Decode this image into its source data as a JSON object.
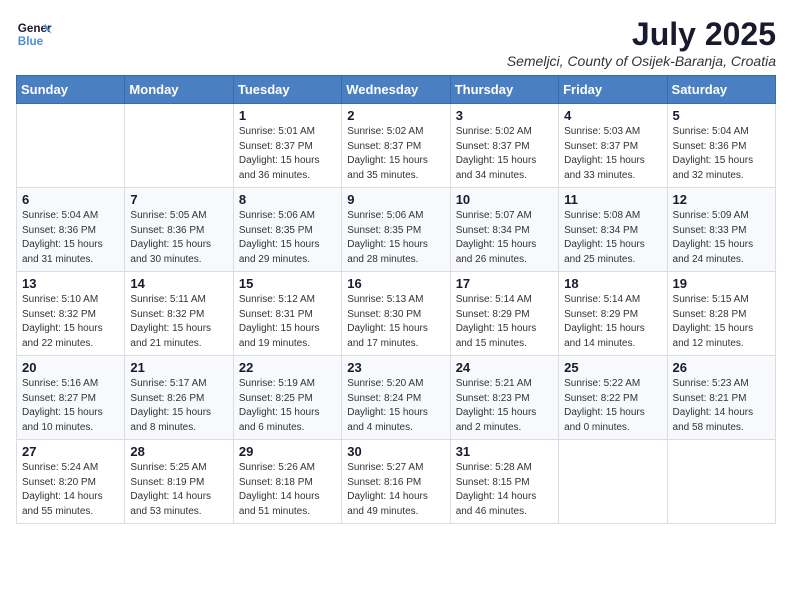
{
  "header": {
    "logo_line1": "General",
    "logo_line2": "Blue",
    "month_title": "July 2025",
    "subtitle": "Semeljci, County of Osijek-Baranja, Croatia"
  },
  "days_of_week": [
    "Sunday",
    "Monday",
    "Tuesday",
    "Wednesday",
    "Thursday",
    "Friday",
    "Saturday"
  ],
  "weeks": [
    [
      {
        "day": "",
        "info": ""
      },
      {
        "day": "",
        "info": ""
      },
      {
        "day": "1",
        "info": "Sunrise: 5:01 AM\nSunset: 8:37 PM\nDaylight: 15 hours and 36 minutes."
      },
      {
        "day": "2",
        "info": "Sunrise: 5:02 AM\nSunset: 8:37 PM\nDaylight: 15 hours and 35 minutes."
      },
      {
        "day": "3",
        "info": "Sunrise: 5:02 AM\nSunset: 8:37 PM\nDaylight: 15 hours and 34 minutes."
      },
      {
        "day": "4",
        "info": "Sunrise: 5:03 AM\nSunset: 8:37 PM\nDaylight: 15 hours and 33 minutes."
      },
      {
        "day": "5",
        "info": "Sunrise: 5:04 AM\nSunset: 8:36 PM\nDaylight: 15 hours and 32 minutes."
      }
    ],
    [
      {
        "day": "6",
        "info": "Sunrise: 5:04 AM\nSunset: 8:36 PM\nDaylight: 15 hours and 31 minutes."
      },
      {
        "day": "7",
        "info": "Sunrise: 5:05 AM\nSunset: 8:36 PM\nDaylight: 15 hours and 30 minutes."
      },
      {
        "day": "8",
        "info": "Sunrise: 5:06 AM\nSunset: 8:35 PM\nDaylight: 15 hours and 29 minutes."
      },
      {
        "day": "9",
        "info": "Sunrise: 5:06 AM\nSunset: 8:35 PM\nDaylight: 15 hours and 28 minutes."
      },
      {
        "day": "10",
        "info": "Sunrise: 5:07 AM\nSunset: 8:34 PM\nDaylight: 15 hours and 26 minutes."
      },
      {
        "day": "11",
        "info": "Sunrise: 5:08 AM\nSunset: 8:34 PM\nDaylight: 15 hours and 25 minutes."
      },
      {
        "day": "12",
        "info": "Sunrise: 5:09 AM\nSunset: 8:33 PM\nDaylight: 15 hours and 24 minutes."
      }
    ],
    [
      {
        "day": "13",
        "info": "Sunrise: 5:10 AM\nSunset: 8:32 PM\nDaylight: 15 hours and 22 minutes."
      },
      {
        "day": "14",
        "info": "Sunrise: 5:11 AM\nSunset: 8:32 PM\nDaylight: 15 hours and 21 minutes."
      },
      {
        "day": "15",
        "info": "Sunrise: 5:12 AM\nSunset: 8:31 PM\nDaylight: 15 hours and 19 minutes."
      },
      {
        "day": "16",
        "info": "Sunrise: 5:13 AM\nSunset: 8:30 PM\nDaylight: 15 hours and 17 minutes."
      },
      {
        "day": "17",
        "info": "Sunrise: 5:14 AM\nSunset: 8:29 PM\nDaylight: 15 hours and 15 minutes."
      },
      {
        "day": "18",
        "info": "Sunrise: 5:14 AM\nSunset: 8:29 PM\nDaylight: 15 hours and 14 minutes."
      },
      {
        "day": "19",
        "info": "Sunrise: 5:15 AM\nSunset: 8:28 PM\nDaylight: 15 hours and 12 minutes."
      }
    ],
    [
      {
        "day": "20",
        "info": "Sunrise: 5:16 AM\nSunset: 8:27 PM\nDaylight: 15 hours and 10 minutes."
      },
      {
        "day": "21",
        "info": "Sunrise: 5:17 AM\nSunset: 8:26 PM\nDaylight: 15 hours and 8 minutes."
      },
      {
        "day": "22",
        "info": "Sunrise: 5:19 AM\nSunset: 8:25 PM\nDaylight: 15 hours and 6 minutes."
      },
      {
        "day": "23",
        "info": "Sunrise: 5:20 AM\nSunset: 8:24 PM\nDaylight: 15 hours and 4 minutes."
      },
      {
        "day": "24",
        "info": "Sunrise: 5:21 AM\nSunset: 8:23 PM\nDaylight: 15 hours and 2 minutes."
      },
      {
        "day": "25",
        "info": "Sunrise: 5:22 AM\nSunset: 8:22 PM\nDaylight: 15 hours and 0 minutes."
      },
      {
        "day": "26",
        "info": "Sunrise: 5:23 AM\nSunset: 8:21 PM\nDaylight: 14 hours and 58 minutes."
      }
    ],
    [
      {
        "day": "27",
        "info": "Sunrise: 5:24 AM\nSunset: 8:20 PM\nDaylight: 14 hours and 55 minutes."
      },
      {
        "day": "28",
        "info": "Sunrise: 5:25 AM\nSunset: 8:19 PM\nDaylight: 14 hours and 53 minutes."
      },
      {
        "day": "29",
        "info": "Sunrise: 5:26 AM\nSunset: 8:18 PM\nDaylight: 14 hours and 51 minutes."
      },
      {
        "day": "30",
        "info": "Sunrise: 5:27 AM\nSunset: 8:16 PM\nDaylight: 14 hours and 49 minutes."
      },
      {
        "day": "31",
        "info": "Sunrise: 5:28 AM\nSunset: 8:15 PM\nDaylight: 14 hours and 46 minutes."
      },
      {
        "day": "",
        "info": ""
      },
      {
        "day": "",
        "info": ""
      }
    ]
  ]
}
